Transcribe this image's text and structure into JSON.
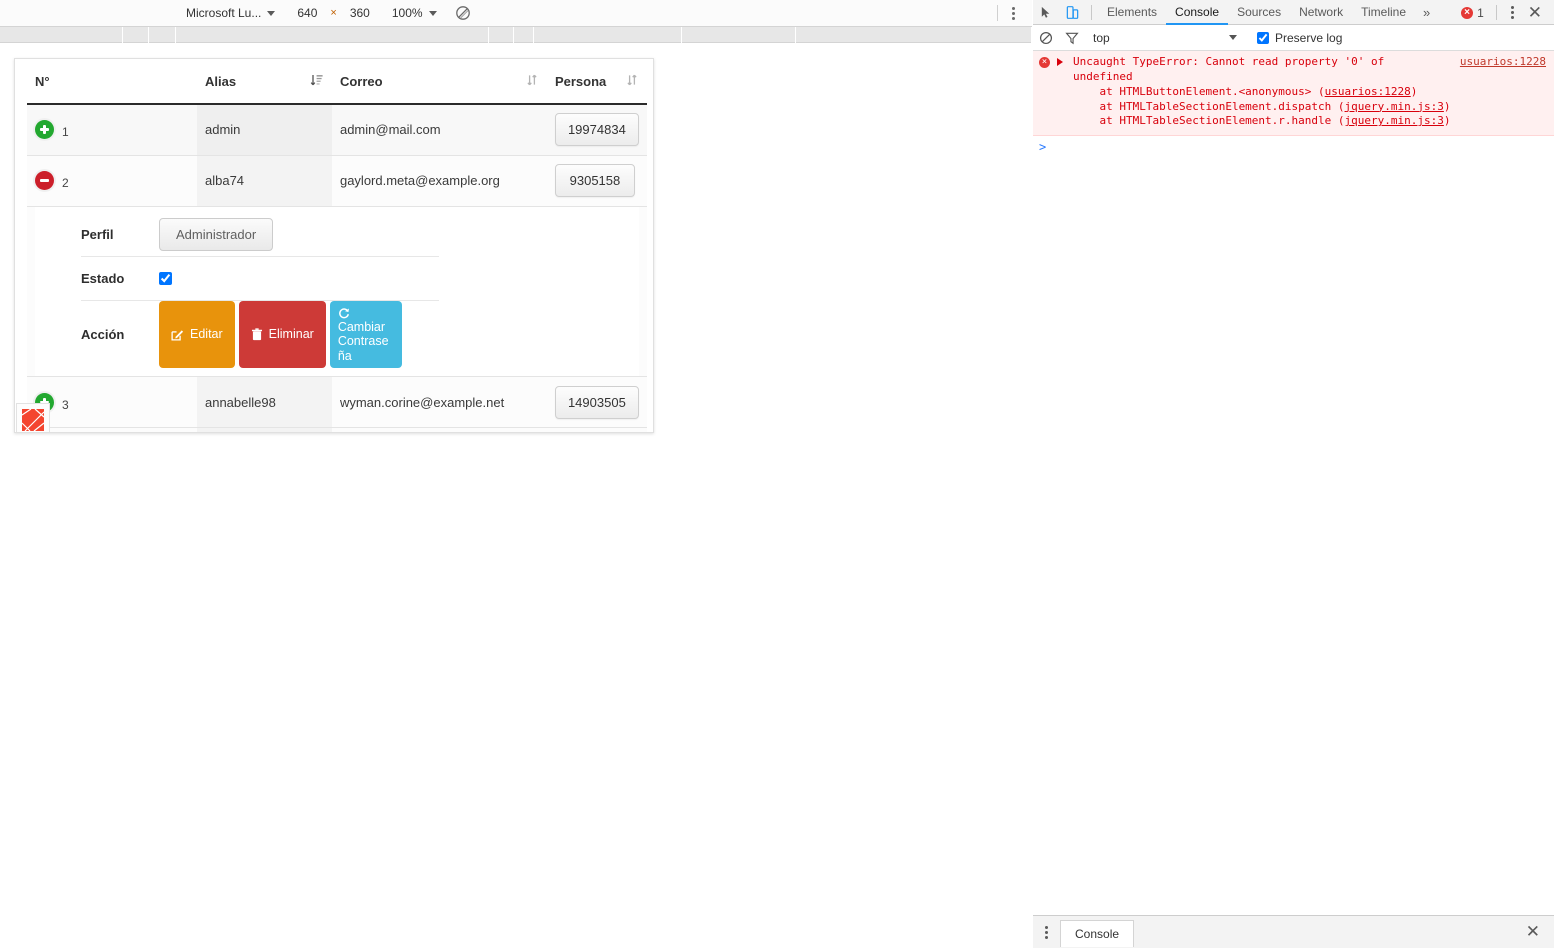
{
  "device_toolbar": {
    "device_name": "Microsoft Lu...",
    "width": "640",
    "height": "360",
    "separator": "×",
    "zoom": "100%",
    "rotate_icon": "rotate-disabled-icon",
    "menu_icon": "kebab-menu-icon"
  },
  "page": {
    "table": {
      "columns": [
        {
          "label": "N°",
          "sort_icon": "none"
        },
        {
          "label": "Alias",
          "sort_icon": "sort-amount-desc-icon"
        },
        {
          "label": "Correo",
          "sort_icon": "sort-updown-icon"
        },
        {
          "label": "Persona",
          "sort_icon": "sort-updown-icon"
        }
      ],
      "rows": [
        {
          "expander": "plus-icon",
          "n": "1",
          "alias": "admin",
          "correo": "admin@mail.com",
          "persona": "19974834",
          "expanded": false
        },
        {
          "expander": "minus-icon",
          "n": "2",
          "alias": "alba74",
          "correo": "gaylord.meta@example.org",
          "persona": "9305158",
          "expanded": true
        },
        {
          "expander": "plus-icon",
          "n": "3",
          "alias": "annabelle98",
          "correo": "wyman.corine@example.net",
          "persona": "14903505",
          "expanded": false
        },
        {
          "expander": "plus-icon",
          "n": "",
          "alias": "",
          "correo": "",
          "persona": "",
          "expanded": false
        }
      ]
    },
    "detail": {
      "perfil_label": "Perfil",
      "perfil_value": "Administrador",
      "estado_label": "Estado",
      "estado_checked": true,
      "accion_label": "Acción",
      "buttons": [
        {
          "label": "Editar",
          "icon": "pencil-square-icon",
          "color": "#e8930c"
        },
        {
          "label": "Eliminar",
          "icon": "trash-icon",
          "color": "#cd3a37"
        },
        {
          "label": "Cambiar Contraseña",
          "icon": "refresh-icon",
          "color": "#45bbe0"
        }
      ]
    },
    "corner_widget_icon": "red-broken-tile-icon"
  },
  "devtools": {
    "tools": [
      {
        "name": "inspect-element-icon"
      },
      {
        "name": "device-toolbar-icon"
      }
    ],
    "tabs": [
      {
        "label": "Elements",
        "active": false
      },
      {
        "label": "Console",
        "active": true
      },
      {
        "label": "Sources",
        "active": false
      },
      {
        "label": "Network",
        "active": false
      },
      {
        "label": "Timeline",
        "active": false
      }
    ],
    "more_tabs": "»",
    "error_count": "1",
    "menu_icon": "kebab-menu-icon",
    "close_icon": "close-icon",
    "filter_bar": {
      "clear_icon": "clear-console-icon",
      "filter_icon": "filter-funnel-icon",
      "context": "top",
      "preserve_log_label": "Preserve log",
      "preserve_log_checked": true
    },
    "console": {
      "error": {
        "message": "Uncaught TypeError: Cannot read property '0' of undefined",
        "source": "usuarios:1228",
        "stack": [
          {
            "text": "    at HTMLButtonElement.<anonymous> (",
            "link": "usuarios:1228",
            "tail": ")"
          },
          {
            "text": "    at HTMLTableSectionElement.dispatch (",
            "link": "jquery.min.js:3",
            "tail": ")"
          },
          {
            "text": "    at HTMLTableSectionElement.r.handle (",
            "link": "jquery.min.js:3",
            "tail": ")"
          }
        ]
      },
      "prompt": ">"
    },
    "drawer": {
      "menu_icon": "kebab-menu-icon",
      "tab_label": "Console",
      "close_icon": "close-icon"
    }
  },
  "colors": {
    "accent_blue": "#2196f3",
    "error_red": "#e53935",
    "expand_green": "#23a830",
    "collapse_red": "#cc1f2a"
  }
}
